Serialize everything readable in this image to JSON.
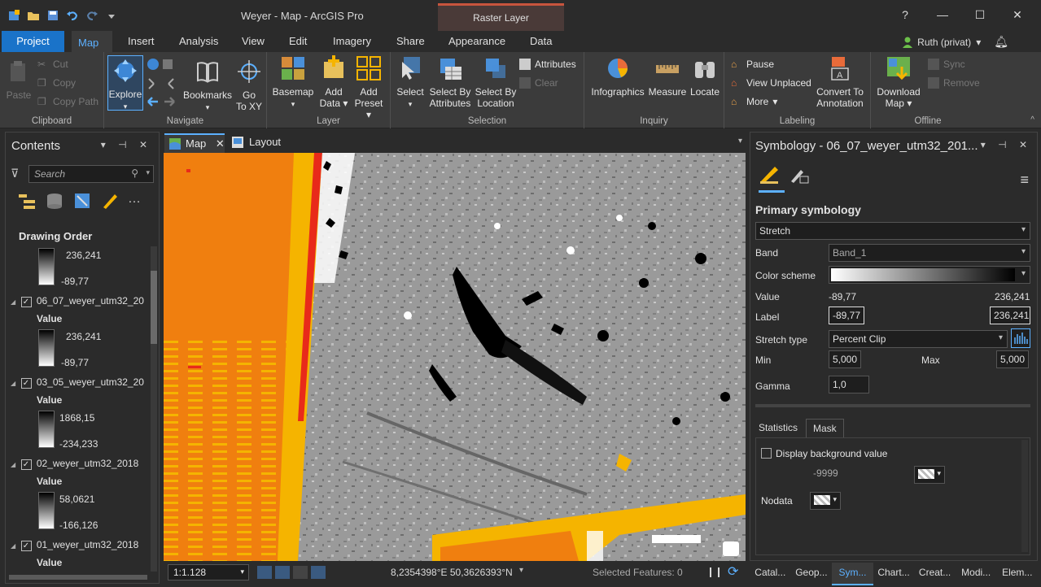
{
  "window": {
    "title": "Weyer - Map - ArcGIS Pro",
    "context_tab": "Raster Layer",
    "help": "?"
  },
  "ribbon_tabs": [
    "Project",
    "Map",
    "Insert",
    "Analysis",
    "View",
    "Edit",
    "Imagery",
    "Share",
    "Appearance",
    "Data"
  ],
  "user": {
    "name": "Ruth (privat)"
  },
  "ribbon": {
    "clipboard": {
      "label": "Clipboard",
      "paste": "Paste",
      "cut": "Cut",
      "copy": "Copy",
      "copy_path": "Copy Path"
    },
    "navigate": {
      "label": "Navigate",
      "explore": "Explore",
      "bookmarks": "Bookmarks",
      "goto1": "Go",
      "goto2": "To XY"
    },
    "layer": {
      "label": "Layer",
      "basemap": "Basemap",
      "add_data1": "Add",
      "add_data2": "Data",
      "add_preset1": "Add",
      "add_preset2": "Preset"
    },
    "selection": {
      "label": "Selection",
      "select": "Select",
      "by_attr1": "Select By",
      "by_attr2": "Attributes",
      "by_loc1": "Select By",
      "by_loc2": "Location",
      "attributes": "Attributes",
      "clear": "Clear"
    },
    "inquiry": {
      "label": "Inquiry",
      "infographics": "Infographics",
      "measure": "Measure",
      "locate": "Locate"
    },
    "labeling": {
      "label": "Labeling",
      "pause": "Pause",
      "view_unplaced": "View Unplaced",
      "more": "More",
      "convert1": "Convert To",
      "convert2": "Annotation"
    },
    "offline": {
      "label": "Offline",
      "download1": "Download",
      "download2": "Map",
      "sync": "Sync",
      "remove": "Remove"
    }
  },
  "contents": {
    "title": "Contents",
    "search_placeholder": "Search",
    "drawing_order": "Drawing Order",
    "value_label": "Value",
    "items": [
      {
        "name": "",
        "max": "236,241",
        "min": "-89,77"
      },
      {
        "name": "06_07_weyer_utm32_20",
        "max": "236,241",
        "min": "-89,77"
      },
      {
        "name": "03_05_weyer_utm32_20",
        "max": "1868,15",
        "min": "-234,233"
      },
      {
        "name": "02_weyer_utm32_2018",
        "max": "58,0621",
        "min": "-166,126"
      },
      {
        "name": "01_weyer_utm32_2018",
        "max": "",
        "min": ""
      }
    ]
  },
  "map_tabs": {
    "map": "Map",
    "layout": "Layout"
  },
  "status": {
    "scale": "1:1.128",
    "coordinates": "8,2354398°E 50,3626393°N",
    "selected_features": "Selected Features: 0"
  },
  "symbology": {
    "title": "Symbology - 06_07_weyer_utm32_201...",
    "primary": "Primary symbology",
    "renderer": "Stretch",
    "band_label": "Band",
    "band_value": "Band_1",
    "color_scheme_label": "Color scheme",
    "value_label": "Value",
    "value_min": "-89,77",
    "value_max": "236,241",
    "label_label": "Label",
    "label_min": "-89,77",
    "label_max": "236,241",
    "stretch_type_label": "Stretch type",
    "stretch_type": "Percent Clip",
    "min_label": "Min",
    "min_value": "5,000",
    "max_label": "Max",
    "max_value": "5,000",
    "gamma_label": "Gamma",
    "gamma_value": "1,0",
    "tab_statistics": "Statistics",
    "tab_mask": "Mask",
    "display_bg": "Display background value",
    "bg_value": "-9999",
    "nodata_label": "Nodata"
  },
  "bottom_tabs": [
    "Catal...",
    "Geop...",
    "Sym...",
    "Chart...",
    "Creat...",
    "Modi...",
    "Elem..."
  ],
  "colors": {
    "accent": "#5cb0ff",
    "project": "#1a73c9",
    "orange": "#f07f0f",
    "yellow": "#f5b400"
  }
}
